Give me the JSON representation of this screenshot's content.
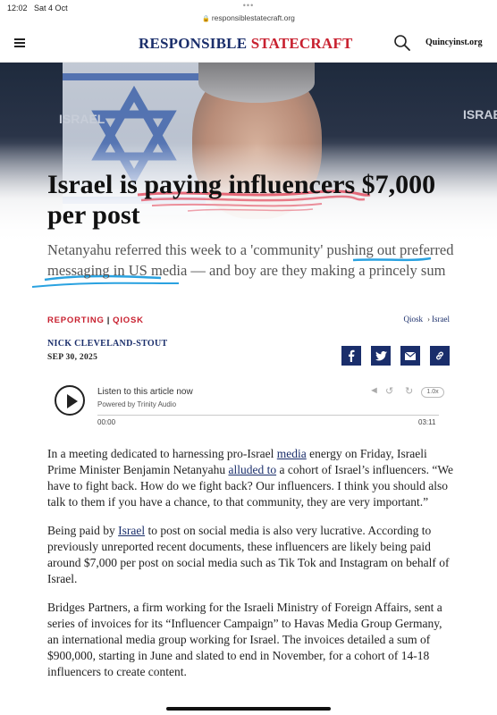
{
  "status": {
    "time": "12:02",
    "date": "Sat 4 Oct",
    "dots": "•••",
    "url": "responsiblestatecraft.org"
  },
  "header": {
    "logo_part1": "RESPONSIBLE",
    "logo_part2": "STATECRAFT",
    "quincy_link": "Quincyinst.org"
  },
  "hero": {
    "logo_text": "ISRAEL"
  },
  "article": {
    "headline": "Israel is paying influencers $7,000 per post",
    "dek": "Netanyahu referred this week to a 'community' pushing out preferred messaging in US media — and boy are they making a princely sum",
    "tag1": "REPORTING",
    "tag_sep": "|",
    "tag2": "QIOSK",
    "crumb1": "Qiosk",
    "crumb_arrow": "›",
    "crumb2": "Israel",
    "author": "NICK CLEVELAND-STOUT",
    "date": "SEP 30, 2025"
  },
  "player": {
    "title": "Listen to this article now",
    "powered": "Powered by Trinity Audio",
    "speed": "1.0x",
    "time_start": "00:00",
    "time_end": "03:11"
  },
  "body": {
    "p1_a": "In a meeting dedicated to harnessing pro-Israel ",
    "p1_link1": "media",
    "p1_b": " energy on Friday, Israeli Prime Minister Benjamin Netanyahu ",
    "p1_link2": "alluded to",
    "p1_c": " a cohort of Israel’s influencers. “We have to fight back. How do we fight back? Our influencers. I think you should also talk to them if you have a chance, to that community, they are very important.”",
    "p2_a": "Being paid by ",
    "p2_link": "Israel",
    "p2_b": " to post on social media is also very lucrative. According to previously unreported recent documents, these influencers are likely being paid around $7,000 per post on social media such as Tik Tok and Instagram on behalf of Israel.",
    "p3": "Bridges Partners, a firm working for the Israeli Ministry of Foreign Affairs, sent a series of invoices for its “Influencer Campaign” to Havas Media Group Germany, an international media group working for Israel. The invoices detailed a sum of $900,000, starting in June and slated to end in November, for a cohort of 14-18 influencers to create content."
  },
  "colors": {
    "navy": "#1a2e6b",
    "red": "#c8202f",
    "highlight_red": "#e2475b",
    "highlight_blue": "#2aa2e0"
  },
  "icons": [
    "menu-icon",
    "search-icon",
    "facebook-icon",
    "twitter-icon",
    "email-icon",
    "link-icon",
    "play-icon",
    "share-icon",
    "rewind-icon",
    "forward-icon"
  ]
}
